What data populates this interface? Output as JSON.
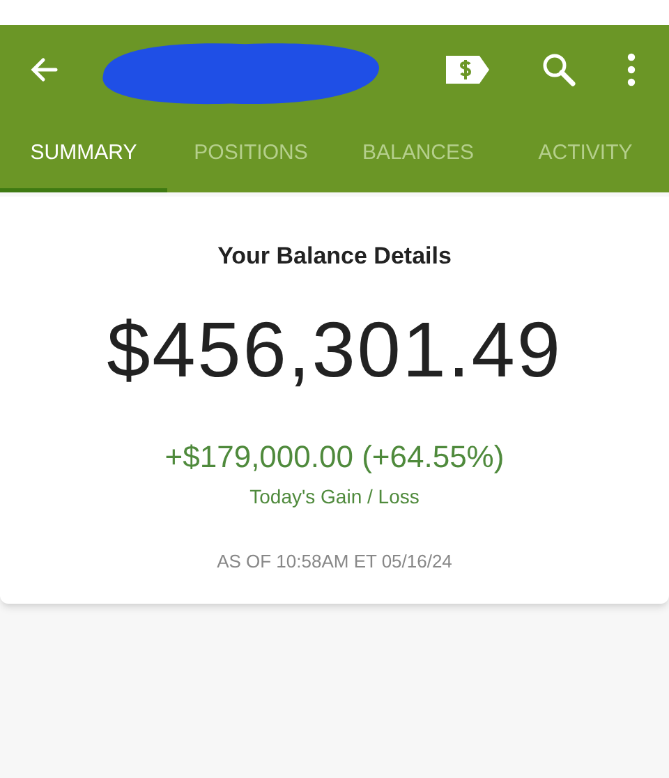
{
  "tabs": [
    {
      "label": "SUMMARY",
      "selected": true
    },
    {
      "label": "POSITIONS",
      "selected": false
    },
    {
      "label": "BALANCES",
      "selected": false
    },
    {
      "label": "ACTIVITY",
      "selected": false
    }
  ],
  "card": {
    "title": "Your Balance Details",
    "balance": "$456,301.49",
    "gain": "+$179,000.00 (+64.55%)",
    "gain_label": "Today's Gain / Loss",
    "as_of": "AS OF 10:58AM ET 05/16/24"
  }
}
